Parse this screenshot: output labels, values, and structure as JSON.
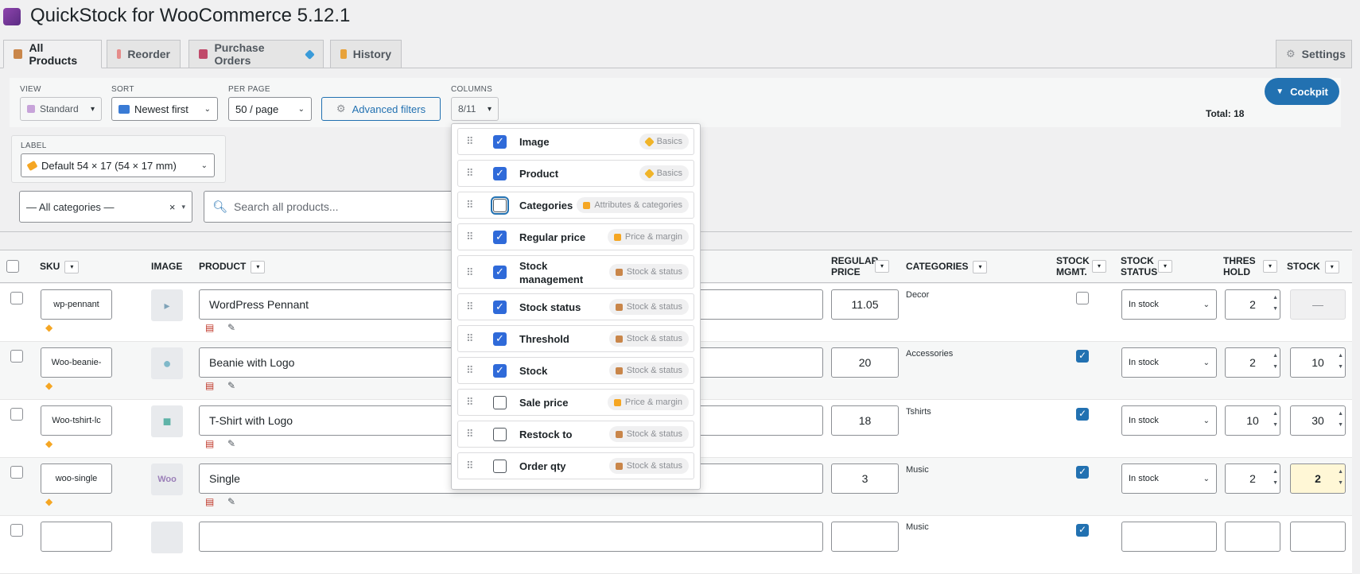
{
  "app": {
    "title": "QuickStock for WooCommerce 5.12.1",
    "logo_icon": "cube-icon"
  },
  "tabs": [
    {
      "label": "All Products",
      "icon": "box-icon",
      "active": true
    },
    {
      "label": "Reorder",
      "icon": "clipboard-icon"
    },
    {
      "label": "Purchase Orders",
      "icon": "cart-icon",
      "badge_icon": "gem-icon"
    },
    {
      "label": "History",
      "icon": "scroll-icon"
    },
    {
      "label": "Settings",
      "icon": "gear-icon"
    }
  ],
  "toolbar": {
    "view": {
      "label": "VIEW",
      "value": "Standard"
    },
    "sort": {
      "label": "SORT",
      "value": "Newest first"
    },
    "per_page": {
      "label": "PER PAGE",
      "value": "50 / page"
    },
    "advanced_filters": "Advanced filters",
    "columns": {
      "label": "COLUMNS",
      "value": "8/11"
    },
    "cockpit": "Cockpit",
    "total": "Total: 18",
    "label_section": {
      "label": "LABEL",
      "value": "Default 54 × 17 (54 × 17 mm)"
    }
  },
  "filters": {
    "category": "— All categories —",
    "clear": "×",
    "search_placeholder": "Search all products..."
  },
  "table": {
    "headers": {
      "sku": "SKU",
      "image": "IMAGE",
      "product": "PRODUCT",
      "regular_price_1": "REGULAR",
      "regular_price_2": "PRICE",
      "categories": "CATEGORIES",
      "stock_mgmt_1": "STOCK",
      "stock_mgmt_2": "MGMT.",
      "stock_status_1": "STOCK",
      "stock_status_2": "STATUS",
      "threshold_1": "THRES",
      "threshold_2": "HOLD",
      "stock": "STOCK"
    },
    "rows": [
      {
        "sku": "wp-pennant",
        "product": "WordPress Pennant",
        "price": "11.05",
        "category": "Decor",
        "managed": false,
        "status": "In stock",
        "threshold": "2",
        "stock": "—"
      },
      {
        "sku": "Woo-beanie-",
        "product": "Beanie with Logo",
        "price": "20",
        "category": "Accessories",
        "managed": true,
        "status": "In stock",
        "threshold": "2",
        "stock": "10"
      },
      {
        "sku": "Woo-tshirt-lc",
        "product": "T-Shirt with Logo",
        "price": "18",
        "category": "Tshirts",
        "managed": true,
        "status": "In stock",
        "threshold": "10",
        "stock": "30"
      },
      {
        "sku": "woo-single",
        "product": "Single",
        "price": "3",
        "category": "Music",
        "managed": true,
        "status": "In stock",
        "threshold": "2",
        "stock": "2"
      },
      {
        "sku": "",
        "product": "",
        "price": "",
        "category": "Music",
        "managed": true,
        "status": "",
        "threshold": "",
        "stock": ""
      }
    ]
  },
  "columns_menu": [
    {
      "label": "Image",
      "checked": true,
      "group": "Basics",
      "group_color": "#f0b429"
    },
    {
      "label": "Product",
      "checked": true,
      "group": "Basics",
      "group_color": "#f0b429"
    },
    {
      "label": "Categories",
      "checked": false,
      "focused": true,
      "group": "Attributes & categories",
      "group_color": "#f5a623"
    },
    {
      "label": "Regular price",
      "checked": true,
      "group": "Price & margin",
      "group_color": "#f5a623"
    },
    {
      "label": "Stock management",
      "checked": true,
      "group": "Stock & status",
      "group_color": "#c9864a"
    },
    {
      "label": "Stock status",
      "checked": true,
      "group": "Stock & status",
      "group_color": "#c9864a"
    },
    {
      "label": "Threshold",
      "checked": true,
      "group": "Stock & status",
      "group_color": "#c9864a"
    },
    {
      "label": "Stock",
      "checked": true,
      "group": "Stock & status",
      "group_color": "#c9864a"
    },
    {
      "label": "Sale price",
      "checked": false,
      "group": "Price & margin",
      "group_color": "#f5a623"
    },
    {
      "label": "Restock to",
      "checked": false,
      "group": "Stock & status",
      "group_color": "#c9864a"
    },
    {
      "label": "Order qty",
      "checked": false,
      "group": "Stock & status",
      "group_color": "#c9864a"
    }
  ],
  "colors": {
    "accent": "#2271b1",
    "checkbox": "#2f6ad9",
    "highlight": "#fff7d6"
  }
}
